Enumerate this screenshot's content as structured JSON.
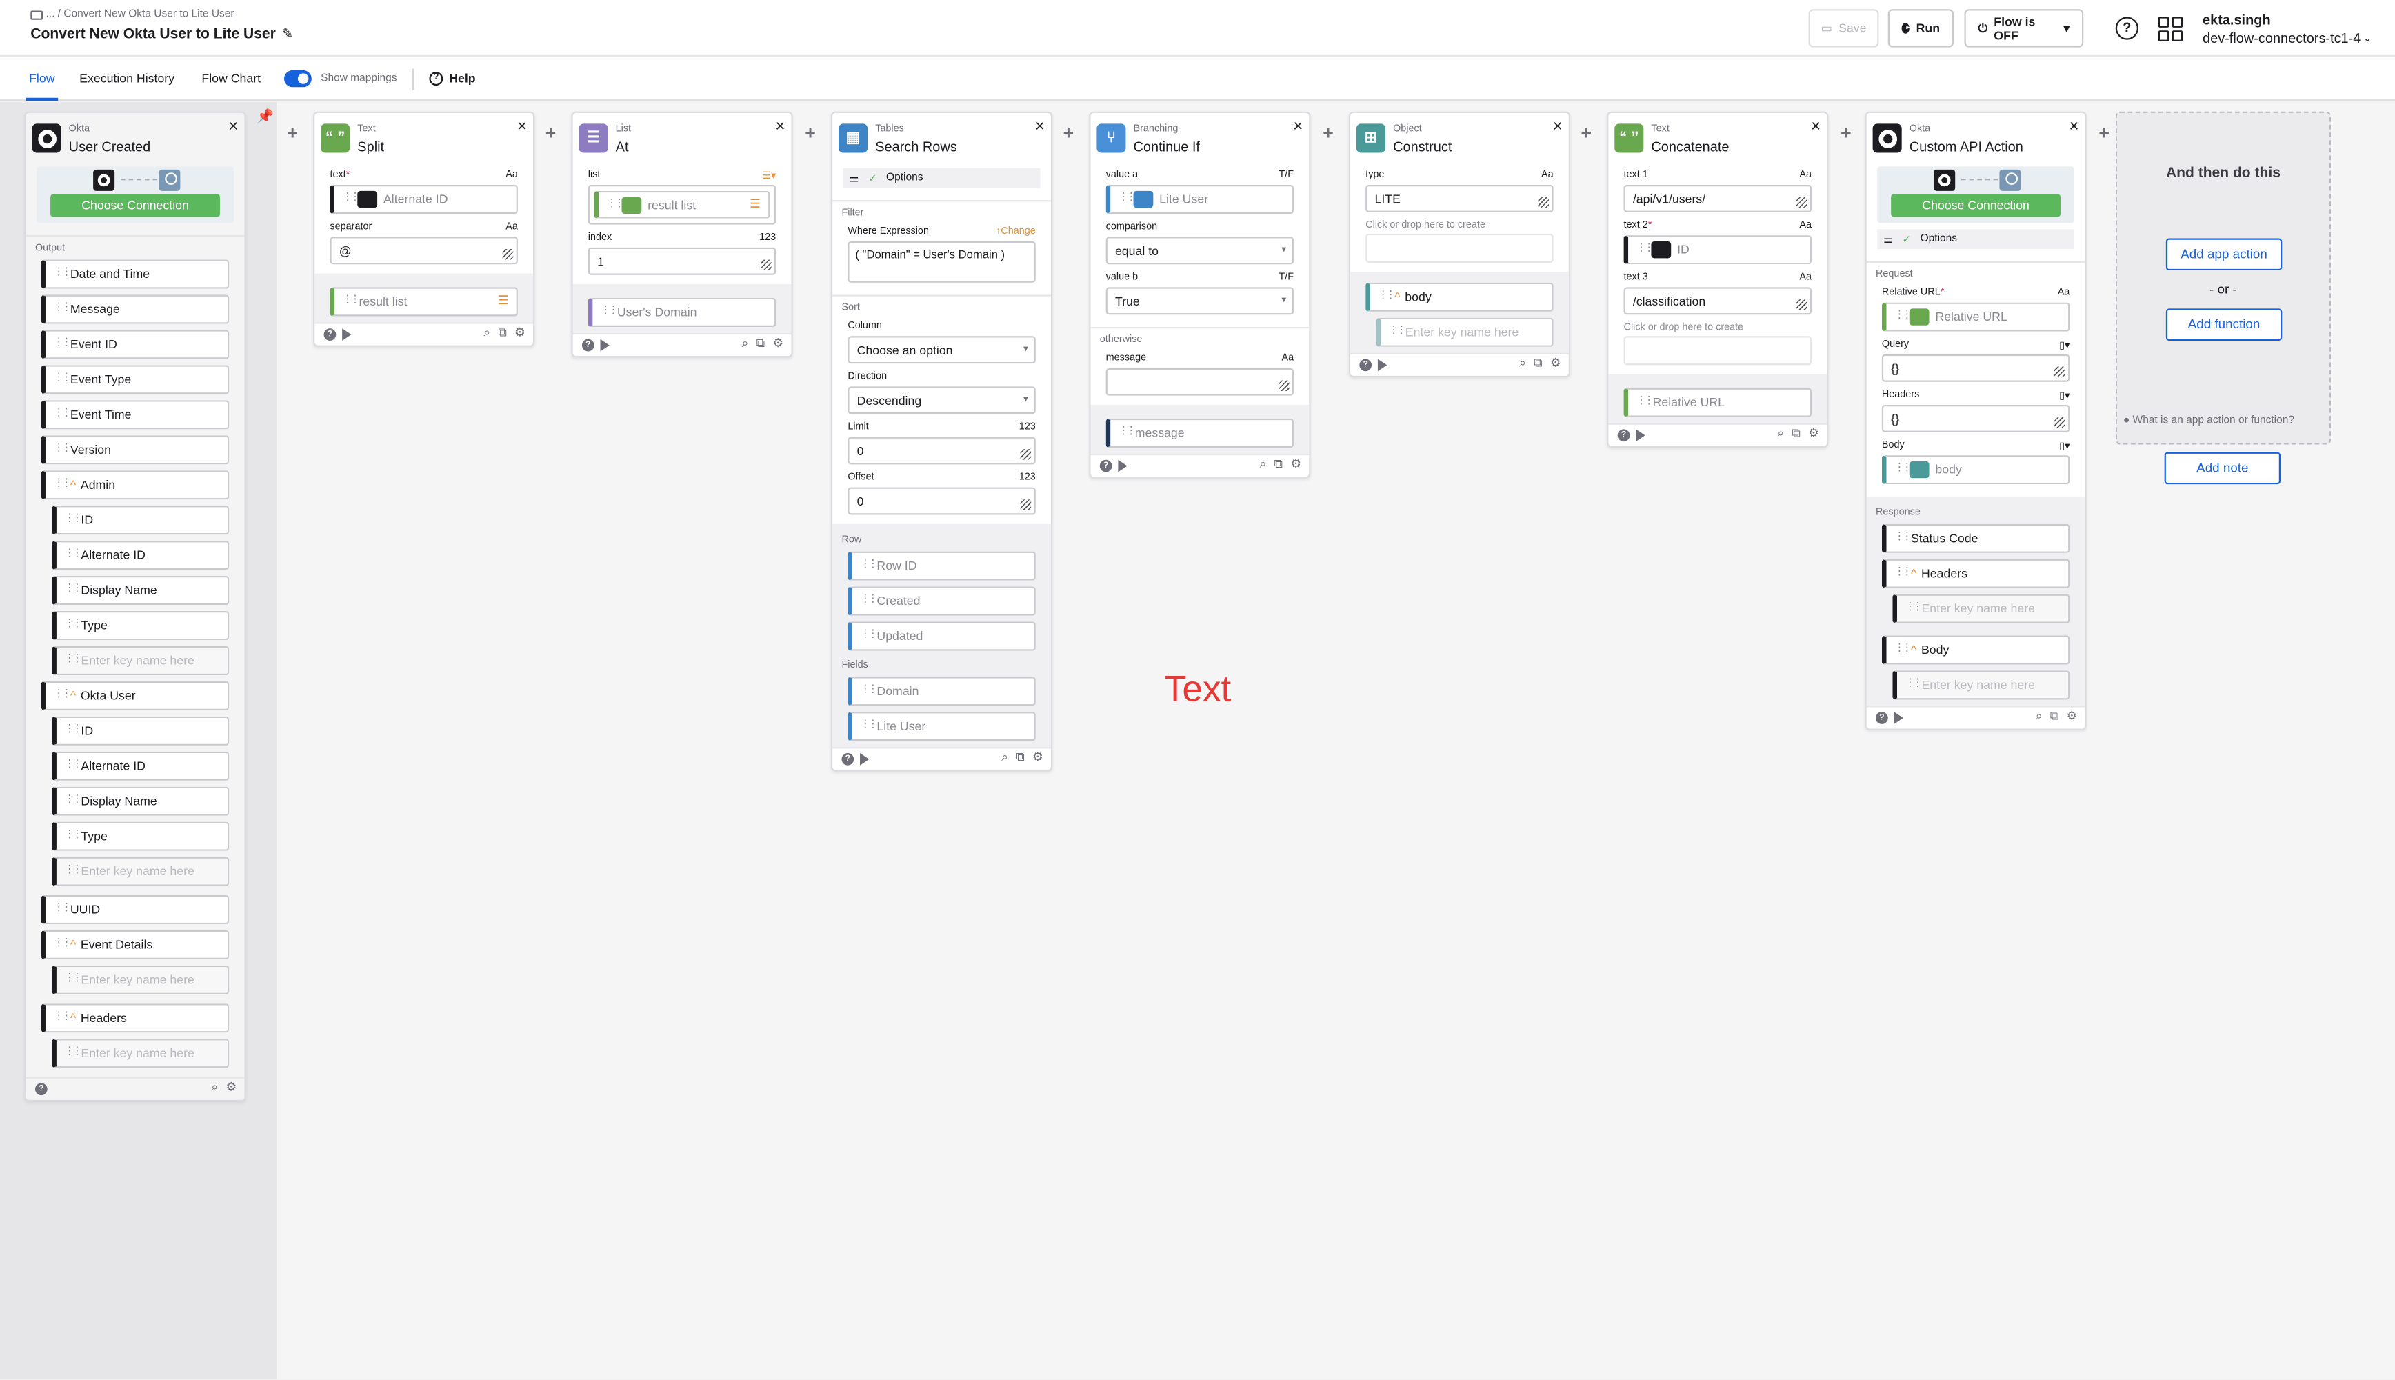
{
  "header": {
    "breadcrumb": "... / Convert New Okta User to Lite User",
    "flow_title": "Convert New Okta User to Lite User",
    "save_label": "Save",
    "run_label": "Run",
    "flow_status": "Flow is OFF",
    "user_name": "ekta.singh",
    "org_name": "dev-flow-connectors-tc1-4"
  },
  "tabs": {
    "flow": "Flow",
    "history": "Execution History",
    "chart": "Flow Chart",
    "mappings": "Show mappings",
    "help": "Help"
  },
  "cards": {
    "okta_event": {
      "type": "Okta",
      "title": "User Created",
      "connect": "Choose Connection",
      "output": "Output",
      "fields": [
        "Date and Time",
        "Message",
        "Event ID",
        "Event Type",
        "Event Time",
        "Version"
      ],
      "admin": "Admin",
      "admin_fields": [
        "ID",
        "Alternate ID",
        "Display Name",
        "Type"
      ],
      "okta_user": "Okta User",
      "okta_user_fields": [
        "ID",
        "Alternate ID",
        "Display Name",
        "Type"
      ],
      "uuid": "UUID",
      "event_details": "Event Details",
      "headers": "Headers",
      "key_placeholder": "Enter key name here"
    },
    "split": {
      "type": "Text",
      "title": "Split",
      "text_label": "text",
      "text_type": "Aa",
      "text_value": "Alternate ID",
      "separator_label": "separator",
      "separator_type": "Aa",
      "separator_value": "@",
      "output": "result list"
    },
    "list_at": {
      "type": "List",
      "title": "At",
      "list_label": "list",
      "list_value": "result list",
      "index_label": "index",
      "index_type": "123",
      "index_value": "1",
      "output": "User's Domain"
    },
    "search_rows": {
      "type": "Tables",
      "title": "Search Rows",
      "options": "Options",
      "filter": "Filter",
      "where_label": "Where Expression",
      "change": "Change",
      "where_value": "( \"Domain\" = User's Domain )",
      "sort": "Sort",
      "column_label": "Column",
      "column_value": "Choose an option",
      "direction_label": "Direction",
      "direction_value": "Descending",
      "limit_label": "Limit",
      "limit_type": "123",
      "limit_value": "0",
      "offset_label": "Offset",
      "offset_type": "123",
      "offset_value": "0",
      "row": "Row",
      "row_fields": [
        "Row ID",
        "Created",
        "Updated"
      ],
      "fields": "Fields",
      "field_items": [
        "Domain",
        "Lite User"
      ]
    },
    "continue_if": {
      "type": "Branching",
      "title": "Continue If",
      "a_label": "value a",
      "a_type": "T/F",
      "a_value": "Lite User",
      "comparison_label": "comparison",
      "comparison_value": "equal to",
      "b_label": "value b",
      "b_type": "T/F",
      "b_value": "True",
      "otherwise": "otherwise",
      "message_label": "message",
      "message_type": "Aa",
      "output": "message"
    },
    "construct": {
      "type": "Object",
      "title": "Construct",
      "type_label": "type",
      "type_type": "Aa",
      "type_value": "LITE",
      "drop_hint": "Click or drop here to create",
      "output": "body",
      "key_placeholder": "Enter key name here"
    },
    "concatenate": {
      "type": "Text",
      "title": "Concatenate",
      "t1_label": "text 1",
      "t1_type": "Aa",
      "t1_value": "/api/v1/users/",
      "t2_label": "text 2",
      "t2_type": "Aa",
      "t2_value": "ID",
      "t3_label": "text 3",
      "t3_type": "Aa",
      "t3_value": "/classification",
      "drop_hint": "Click or drop here to create",
      "output": "Relative URL"
    },
    "custom_api": {
      "type": "Okta",
      "title": "Custom API Action",
      "connect": "Choose Connection",
      "options": "Options",
      "request": "Request",
      "url_label": "Relative URL",
      "url_type": "Aa",
      "url_value": "Relative URL",
      "query_label": "Query",
      "query_value": "{}",
      "headers_label": "Headers",
      "headers_value": "{}",
      "body_label": "Body",
      "body_value": "body",
      "response": "Response",
      "status": "Status Code",
      "resp_headers": "Headers",
      "resp_body": "Body",
      "key_placeholder": "Enter key name here"
    }
  },
  "placeholder": {
    "title": "And then do this",
    "add_app": "Add app action",
    "or": "- or -",
    "add_function": "Add function",
    "question": "What is an app action or function?",
    "add_note": "Add note"
  },
  "annotation": "Text",
  "colors": {
    "accent": "#1662dd",
    "connect_green": "#5cb85c",
    "annotation_red": "#e53935"
  }
}
